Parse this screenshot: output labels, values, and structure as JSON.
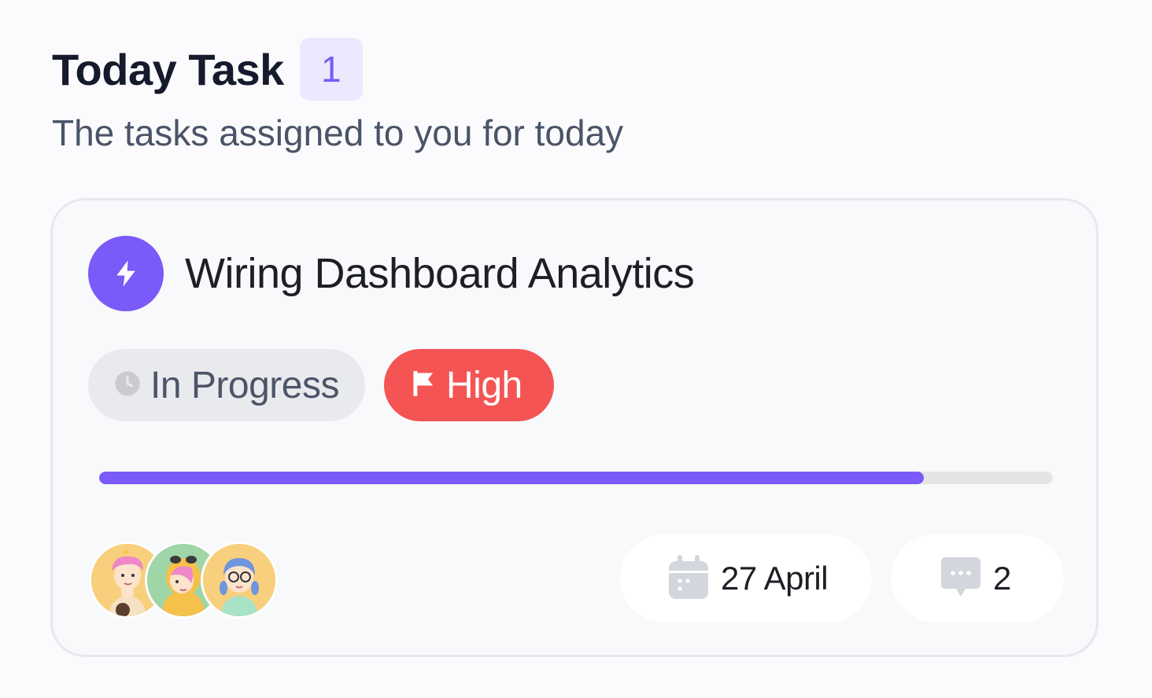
{
  "header": {
    "title": "Today Task",
    "count": "1",
    "subtitle": "The tasks assigned to you for today"
  },
  "task": {
    "title": "Wiring Dashboard Analytics",
    "icon": "lightning-bolt-icon",
    "status": "In Progress",
    "status_icon": "clock-icon",
    "priority": "High",
    "priority_icon": "flag-icon",
    "progress_fraction": 0.865,
    "assignee_count": 3,
    "due_date": "27 April",
    "due_icon": "calendar-icon",
    "comments": "2",
    "comments_icon": "chat-bubble-icon"
  },
  "colors": {
    "accent": "#7a5af8",
    "badge_bg": "#ebe9fe",
    "priority_high": "#f45454",
    "status_bg": "#e9eaed",
    "progress_track": "#e5e5e7"
  }
}
